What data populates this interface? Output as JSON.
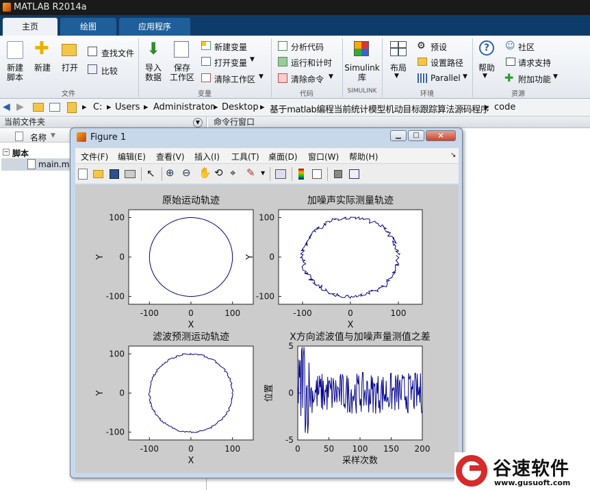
{
  "window": {
    "title": "MATLAB R2014a"
  },
  "tabs": [
    "主页",
    "绘图",
    "应用程序"
  ],
  "ribbon": {
    "file": {
      "new_script": "新建\n脚本",
      "new": "新建",
      "open": "打开",
      "find_files": "查找文件",
      "compare": "比较",
      "group": "文件"
    },
    "variable": {
      "import": "导入\n数据",
      "save": "保存\n工作区",
      "new_var": "新建变量",
      "open_var": "打开变量",
      "clear_ws": "清除工作区",
      "group": "变量"
    },
    "code": {
      "analyze": "分析代码",
      "run_time": "运行和计时",
      "clear_cmd": "清除命令",
      "group": "代码"
    },
    "simulink": {
      "lib": "Simulink\n库",
      "group": "SIMULINK"
    },
    "env": {
      "layout": "布局",
      "prefs": "预设",
      "setpath": "设置路径",
      "parallel": "Parallel",
      "group": "环境"
    },
    "res": {
      "help": "帮助",
      "community": "社区",
      "support": "请求支持",
      "addons": "附加功能",
      "group": "资源"
    }
  },
  "path": [
    "C:",
    "Users",
    "Administrator",
    "Desktop",
    "基于matlab编程当前统计模型机动目标跟踪算法源码程序",
    "code"
  ],
  "left": {
    "title": "当前文件夹",
    "col": "名称",
    "folder": "脚本",
    "file": "main.m"
  },
  "cmd": {
    "title": "命令行窗口"
  },
  "figure": {
    "title": "Figure 1",
    "menu": [
      "文件(F)",
      "编辑(E)",
      "查看(V)",
      "插入(I)",
      "工具(T)",
      "桌面(D)",
      "窗口(W)",
      "帮助(H)"
    ]
  },
  "chart_data": [
    {
      "type": "line",
      "title": "原始运动轨迹",
      "xlabel": "X",
      "ylabel": "Y",
      "xlim": [
        -150,
        150
      ],
      "ylim": [
        -120,
        120
      ],
      "xticks": [
        "-100",
        "0",
        "100"
      ],
      "yticks": [
        "100",
        "0",
        "-100"
      ],
      "series": [
        {
          "shape": "ellipse",
          "rx": 100,
          "ry": 100,
          "noise": 0
        }
      ],
      "color": "#00008b"
    },
    {
      "type": "line",
      "title": "加噪声实际测量轨迹",
      "xlabel": "X",
      "ylabel": "Y",
      "xlim": [
        -150,
        150
      ],
      "ylim": [
        -120,
        120
      ],
      "xticks": [
        "-100",
        "0",
        "100"
      ],
      "yticks": [
        "100",
        "0",
        "-100"
      ],
      "series": [
        {
          "shape": "ellipse",
          "rx": 100,
          "ry": 100,
          "noise": 5
        }
      ],
      "color": "#00008b"
    },
    {
      "type": "line",
      "title": "滤波预测运动轨迹",
      "xlabel": "X",
      "ylabel": "Y",
      "xlim": [
        -150,
        150
      ],
      "ylim": [
        -120,
        120
      ],
      "xticks": [
        "-100",
        "0",
        "100"
      ],
      "yticks": [
        "100",
        "0",
        "-100"
      ],
      "series": [
        {
          "shape": "ellipse",
          "rx": 100,
          "ry": 100,
          "noise": 2
        }
      ],
      "color": "#00008b"
    },
    {
      "type": "line",
      "title": "X方向滤波值与加噪声量测值之差",
      "xlabel": "采样次数",
      "ylabel": "位置",
      "xlim": [
        0,
        200
      ],
      "ylim": [
        -5,
        5
      ],
      "xticks": [
        "0",
        "50",
        "100",
        "150",
        "200"
      ],
      "yticks": [
        "5",
        "0",
        "-5"
      ],
      "series": [
        {
          "shape": "noise",
          "amp": 2.2
        }
      ],
      "color": "#00008b"
    }
  ],
  "watermark": {
    "brand": "谷速软件",
    "url": "www.gusuoft.com"
  }
}
